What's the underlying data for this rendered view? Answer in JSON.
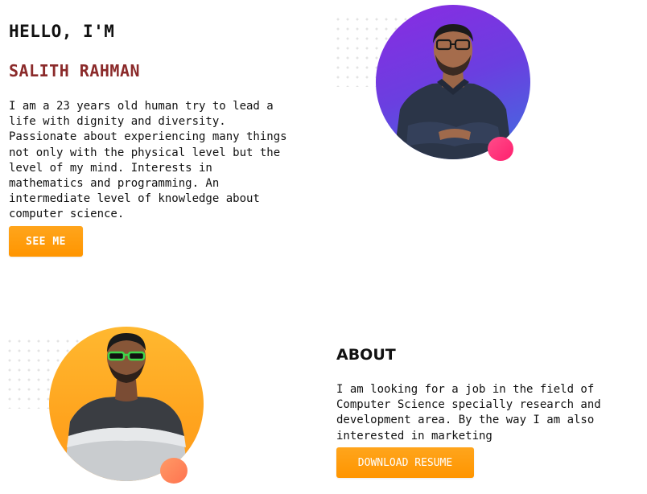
{
  "hero": {
    "greeting": "HELLO, I'M",
    "name": "SALITH RAHMAN",
    "bio": "I am a 23 years old human try to lead a life with dignity and diversity. Passionate about experiencing many things not only with the physical level but the level of my mind. Interests in mathematics and programming. An intermediate level of knowledge about computer science.",
    "see_me_label": "SEE ME"
  },
  "about": {
    "heading": "ABOUT",
    "text": "I am looking for a job in the field of Computer Science specially research and development area. By the way I am also interested in marketing",
    "download_label": "DOWNLOAD RESUME"
  },
  "colors": {
    "accent_button": "#ff9a0e",
    "name_color": "#8b2a2a",
    "top_photo_bg": "#6a3fe0",
    "bottom_photo_bg": "#ffa41e",
    "top_accent_dot": "#ff2a74",
    "bottom_accent_dot": "#ff8058"
  }
}
